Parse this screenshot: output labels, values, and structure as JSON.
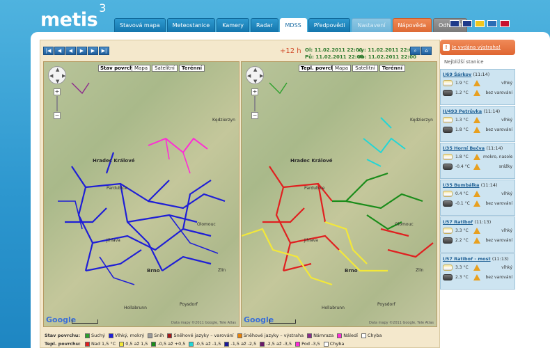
{
  "logo": {
    "name": "metis",
    "superscript": "3"
  },
  "nav": {
    "tabs": [
      {
        "label": "Stavová mapa",
        "state": "normal"
      },
      {
        "label": "Meteostanice",
        "state": "normal"
      },
      {
        "label": "Kamery",
        "state": "normal"
      },
      {
        "label": "Radar",
        "state": "normal"
      },
      {
        "label": "MDSS",
        "state": "active"
      },
      {
        "label": "Předpovědi",
        "state": "normal"
      },
      {
        "label": "Nastavení",
        "state": "disabled"
      },
      {
        "label": "Nápověda",
        "state": "orange"
      },
      {
        "label": "Odhlásit",
        "state": "gray"
      }
    ]
  },
  "flags": [
    {
      "name": "uk-flag-icon",
      "color": "#1d3a8a"
    },
    {
      "name": "uk-flag-icon-2",
      "color": "#1d3a8a"
    },
    {
      "name": "romania-flag-icon",
      "color": "#f2c61d"
    },
    {
      "name": "sweden-flag-icon",
      "color": "#2b6db5"
    },
    {
      "name": "serbia-flag-icon",
      "color": "#c8102e"
    }
  ],
  "viewer": {
    "toolbar": [
      "|◀",
      "◀",
      "◀",
      "▶",
      "▶",
      "▶|"
    ],
    "offset": "+12 h",
    "from": {
      "label_ol": "Ol: 11.02.2011 22:00",
      "label_pu": "Pů: 11.02.2011 22:00"
    },
    "to": {
      "label_vy": "Vy: 11.02.2011 22:00",
      "label_ub": "Ub: 11.02.2011 22:00"
    },
    "map_left_title": "Stav povrchu",
    "map_right_title": "Tepl. povrchu",
    "map_types": [
      "Mapa",
      "Satelitní",
      "Terénní"
    ],
    "cities": [
      {
        "name": "Hradec Králové",
        "big": true
      },
      {
        "name": "Pardubice",
        "big": false
      },
      {
        "name": "Brno",
        "big": true
      },
      {
        "name": "Zlín",
        "big": false
      },
      {
        "name": "Jihlava",
        "big": false
      },
      {
        "name": "Olomouc",
        "big": false
      },
      {
        "name": "Poysdorf",
        "big": false
      },
      {
        "name": "Hollabrunn",
        "big": false
      },
      {
        "name": "Kędzierzyn",
        "big": false
      }
    ],
    "google": "Google",
    "copyright": "Data mapy ©2011 Google, Tele Atlas"
  },
  "legend": {
    "stav_label": "Stav povrchu:",
    "stav_items": [
      {
        "label": "Suchý",
        "color": "#2ca02c"
      },
      {
        "label": "Vlhký, mokrý",
        "color": "#1f1fd6"
      },
      {
        "label": "Sníh",
        "color": "#9a9a9a"
      },
      {
        "label": "Sněhové jazyky – varování",
        "color": "#a61a1a"
      },
      {
        "label": "Sněhové jazyky – výstraha",
        "color": "#e8830c"
      },
      {
        "label": "Námraza",
        "color": "#8c2a8c"
      },
      {
        "label": "Náledí",
        "color": "#ff2bd6"
      },
      {
        "label": "Chyba",
        "color": "#ffffff"
      }
    ],
    "tepl_label": "Tepl. povrchu:",
    "tepl_items": [
      {
        "label": "Nad 1,5 °C",
        "color": "#e02020"
      },
      {
        "label": "0,5 až 1,5",
        "color": "#f3e838"
      },
      {
        "label": "-0,5 až +0,5",
        "color": "#1a8c1a"
      },
      {
        "label": "-0,5 až -1,5",
        "color": "#22d6d6"
      },
      {
        "label": "-1,5 až -2,5",
        "color": "#1a1a9a"
      },
      {
        "label": "-2,5 až -3,5",
        "color": "#6a1a6a"
      },
      {
        "label": "Pod -3,5",
        "color": "#ff2bd6"
      },
      {
        "label": "Chyba",
        "color": "#ffffff"
      }
    ]
  },
  "sidebar": {
    "warning": "Je vydána výstraha!",
    "title": "Nejbližší stanice",
    "stations": [
      {
        "name": "I/69 Šárkov",
        "time": "(11:14)",
        "air_temp": "1.9 °C",
        "air_state": "vlhký",
        "road_temp": "1.2 °C",
        "road_state": "bez varování"
      },
      {
        "name": "II/493 Petrůvka",
        "time": "(11:14)",
        "air_temp": "1.3 °C",
        "air_state": "vlhký",
        "road_temp": "1.8 °C",
        "road_state": "bez varování"
      },
      {
        "name": "I/35 Horní Bečva",
        "time": "(11:14)",
        "air_temp": "1.8 °C",
        "air_state": "mokro, nasoleno",
        "road_temp": "-0.4 °C",
        "road_state": "srážky"
      },
      {
        "name": "I/35 Bumbálka",
        "time": "(11:14)",
        "air_temp": "0.4 °C",
        "air_state": "vlhký",
        "road_temp": "-0.1 °C",
        "road_state": "bez varování"
      },
      {
        "name": "I/57 Ratiboř",
        "time": "(11:13)",
        "air_temp": "3.3 °C",
        "air_state": "vlhký",
        "road_temp": "2.2 °C",
        "road_state": "bez varování"
      },
      {
        "name": "I/57 Ratiboř - most",
        "time": "(11:13)",
        "air_temp": "3.3 °C",
        "air_state": "vlhký",
        "road_temp": "2.3 °C",
        "road_state": "bez varování"
      }
    ]
  }
}
